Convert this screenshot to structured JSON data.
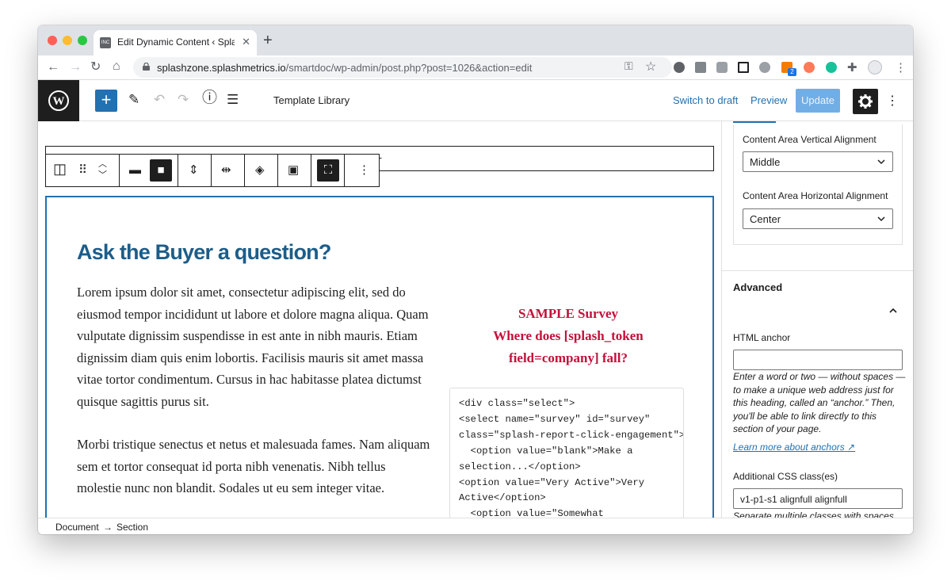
{
  "browser": {
    "tab_title": "Edit Dynamic Content ‹ Splash",
    "tab_favicon_text": "INC",
    "url_host": "splashzone.splashmetrics.io",
    "url_path": "/smartdoc/wp-admin/post.php?post=1026&action=edit",
    "extension_badge": "2"
  },
  "editor_header": {
    "template_library_label": "Template Library",
    "switch_to_draft_label": "Switch to draft",
    "preview_label": "Preview",
    "update_label": "Update"
  },
  "content": {
    "heading": "Ask the Buyer a question?",
    "paragraph_1": "Lorem ipsum dolor sit amet, consectetur adipiscing elit, sed do eiusmod tempor incididunt ut labore et dolore magna aliqua. Quam vulputate dignissim suspendisse in est ante in nibh mauris. Etiam dignissim diam quis enim lobortis. Facilisis mauris sit amet massa vitae tortor condimentum. Cursus in hac habitasse platea dictumst quisque sagittis purus sit.",
    "paragraph_2": "Morbi tristique senectus et netus et malesuada fames. Nam aliquam sem et tortor consequat id porta nibh venenatis. Nibh tellus molestie nunc non blandit. Sodales ut eu sem integer vitae.",
    "survey_title_line_1": "SAMPLE Survey",
    "survey_title_line_2": "Where does [splash_token",
    "survey_title_line_3": "field=company] fall?",
    "code": "<div class=\"select\">\n<select name=\"survey\" id=\"survey\"\nclass=\"splash-report-click-engagement\">\n  <option value=\"blank\">Make a\nselection...</option>\n<option value=\"Very Active\">Very\nActive</option>\n  <option value=\"Somewhat"
  },
  "sidebar": {
    "vertical_alignment_label": "Content Area Vertical Alignment",
    "vertical_alignment_value": "Middle",
    "horizontal_alignment_label": "Content Area Horizontal Alignment",
    "horizontal_alignment_value": "Center",
    "advanced_heading": "Advanced",
    "html_anchor_label": "HTML anchor",
    "html_anchor_value": "",
    "html_anchor_help": "Enter a word or two — without spaces — to make a unique web address just for this heading, called an “anchor.” Then, you'll be able to link directly to this section of your page.",
    "learn_more_link": "Learn more about anchors",
    "css_classes_label": "Additional CSS class(es)",
    "css_classes_value": "v1-p1-s1 alignfull alignfull",
    "css_classes_help": "Separate multiple classes with spaces."
  },
  "breadcrumb": {
    "document": "Document",
    "separator": "→",
    "section": "Section"
  },
  "colors": {
    "wp_blue": "#2271b1",
    "heading_blue": "#1c5d89",
    "survey_red": "#c4103a",
    "update_disabled": "#72aee6"
  }
}
